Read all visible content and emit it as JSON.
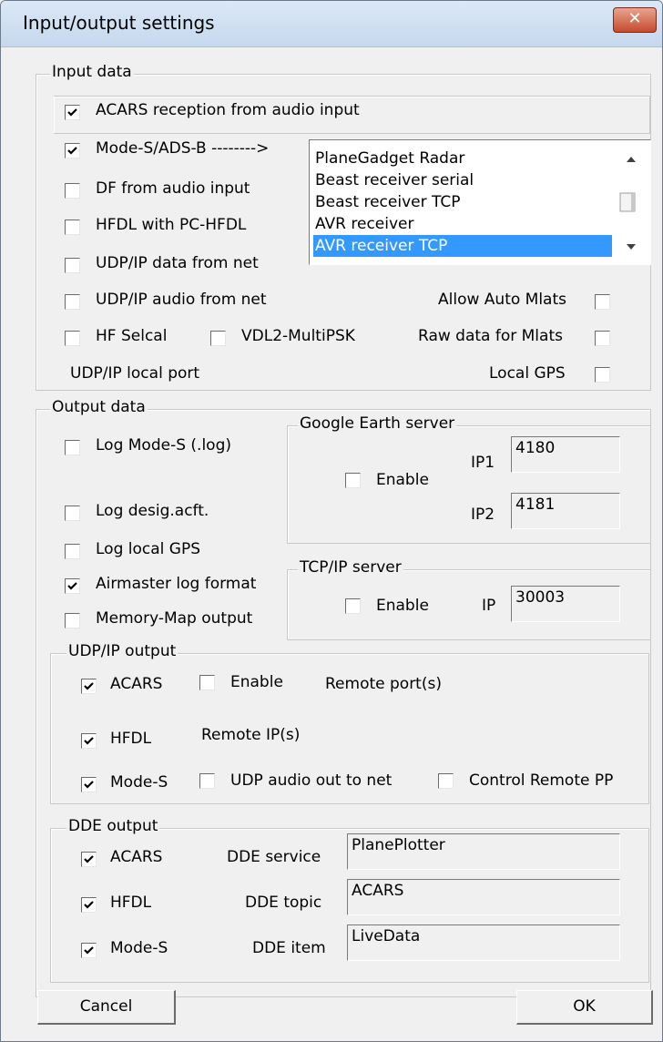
{
  "window": {
    "title": "Input/output settings",
    "close": "✕"
  },
  "input": {
    "legend": "Input data",
    "acars": "ACARS reception from audio input",
    "modes": "Mode-S/ADS-B -------->",
    "df": "DF from audio input",
    "hfdl": "HFDL with PC-HFDL",
    "udp_data": "UDP/IP data from net",
    "udp_audio": "UDP/IP audio from net",
    "hf_selcal": "HF Selcal",
    "vdl2": "VDL2-MultiPSK",
    "local_port": "UDP/IP local port",
    "allow_auto": "Allow Auto Mlats",
    "raw_data": "Raw data for Mlats",
    "local_gps": "Local GPS",
    "receivers": [
      "PlaneGadget Radar",
      "Beast receiver serial",
      "Beast receiver TCP",
      "AVR receiver",
      "AVR receiver TCP"
    ],
    "selected_receiver": "AVR receiver TCP"
  },
  "output": {
    "legend": "Output data",
    "log_modes": "Log Mode-S (.log)",
    "log_desig": "Log desig.acft.",
    "log_gps": "Log local GPS",
    "airmaster": "Airmaster log format",
    "memmap": "Memory-Map output",
    "google": {
      "legend": "Google Earth server",
      "enable": "Enable",
      "ip1_label": "IP1",
      "ip1": "4180",
      "ip2_label": "IP2",
      "ip2": "4181"
    },
    "tcp": {
      "legend": "TCP/IP server",
      "enable": "Enable",
      "ip_label": "IP",
      "ip": "30003"
    },
    "udp": {
      "legend": "UDP/IP output",
      "acars": "ACARS",
      "enable": "Enable",
      "remote_ports": "Remote port(s)",
      "hfdl": "HFDL",
      "remote_ips": "Remote IP(s)",
      "modes": "Mode-S",
      "udp_audio": "UDP audio out to net",
      "control_pp": "Control Remote PP"
    },
    "dde": {
      "legend": "DDE output",
      "acars": "ACARS",
      "service_label": "DDE service",
      "service": "PlanePlotter",
      "hfdl": "HFDL",
      "topic_label": "DDE topic",
      "topic": "ACARS",
      "modes": "Mode-S",
      "item_label": "DDE item",
      "item": "LiveData"
    }
  },
  "buttons": {
    "cancel": "Cancel",
    "ok": "OK"
  }
}
